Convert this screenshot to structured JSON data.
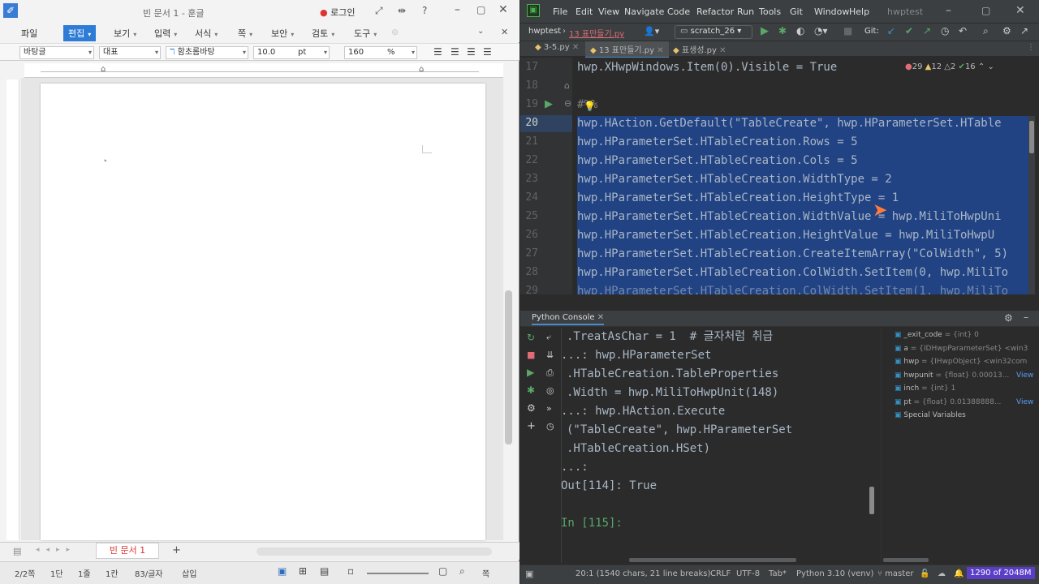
{
  "hwp": {
    "window_title": "빈 문서 1 - 훈글",
    "login_label": "로그인",
    "menu": [
      "파일",
      "편집",
      "보기",
      "입력",
      "서식",
      "쪽",
      "보안",
      "검토",
      "도구"
    ],
    "active_menu": "편집",
    "format": {
      "style": "바탕글",
      "face": "대표",
      "font": "함초롬바탕",
      "size": "10.0",
      "unit": "pt",
      "zoom": "160",
      "zoom_unit": "%"
    },
    "doc_tab": "빈 문서 1",
    "status": {
      "page": "2/2쪽",
      "section": "1단",
      "line": "1줄",
      "col": "1칸",
      "chars": "83/글자",
      "mode": "삽입",
      "extra": "쪽"
    }
  },
  "ide": {
    "menu": [
      "File",
      "Edit",
      "View",
      "Navigate",
      "Code",
      "Refactor",
      "Run",
      "Tools",
      "Git",
      "Window",
      "Help"
    ],
    "project_title": "hwptest",
    "nav": {
      "project": "hwptest",
      "file": "13 표만들기.py",
      "run_config": "scratch_26",
      "git_label": "Git:"
    },
    "file_tabs": [
      "3-5.py",
      "13 표만들기.py",
      "표생성.py"
    ],
    "inspections": {
      "errors": "29",
      "warnings": "12",
      "weak": "2",
      "ok": "16"
    },
    "code": [
      {
        "n": "17",
        "text": "hwp.XHwpWindows.Item(0).Visible = True"
      },
      {
        "n": "18",
        "text": ""
      },
      {
        "n": "19",
        "text": "#%%"
      },
      {
        "n": "20",
        "text": "hwp.HAction.GetDefault(\"TableCreate\", hwp.HParameterSet.HTable"
      },
      {
        "n": "21",
        "text": "hwp.HParameterSet.HTableCreation.Rows = 5"
      },
      {
        "n": "22",
        "text": "hwp.HParameterSet.HTableCreation.Cols = 5"
      },
      {
        "n": "23",
        "text": "hwp.HParameterSet.HTableCreation.WidthType = 2"
      },
      {
        "n": "24",
        "text": "hwp.HParameterSet.HTableCreation.HeightType = 1"
      },
      {
        "n": "25",
        "text": "hwp.HParameterSet.HTableCreation.WidthValue = hwp.MiliToHwpUni"
      },
      {
        "n": "26",
        "text": "hwp.HParameterSet.HTableCreation.HeightValue = hwp.MiliToHwpU"
      },
      {
        "n": "27",
        "text": "hwp.HParameterSet.HTableCreation.CreateItemArray(\"ColWidth\", 5)"
      },
      {
        "n": "28",
        "text": "hwp.HParameterSet.HTableCreation.ColWidth.SetItem(0, hwp.MiliTo"
      },
      {
        "n": "29",
        "text": "hwp.HParameterSet.HTableCreation.ColWidth.SetItem(1, hwp.MiliTo"
      }
    ],
    "console_title": "Python Console",
    "console_lines": [
      ".TreatAsChar = 1  # 글자처럼 취급",
      "...: hwp.HParameterSet",
      ".HTableCreation.TableProperties",
      ".Width = hwp.MiliToHwpUnit(148)",
      "...: hwp.HAction.Execute",
      "(\"TableCreate\", hwp.HParameterSet",
      ".HTableCreation.HSet)",
      "...:",
      "Out[114]: True",
      "",
      "In [115]:"
    ],
    "variables": [
      {
        "name": "_exit_code",
        "type": "= {int} 0",
        "view": ""
      },
      {
        "name": "a",
        "type": "= {IDHwpParameterSet} <win3",
        "view": ""
      },
      {
        "name": "hwp",
        "type": "= {IHwpObject} <win32com",
        "view": ""
      },
      {
        "name": "hwpunit",
        "type": "= {float} 0.00013...",
        "view": "View"
      },
      {
        "name": "inch",
        "type": "= {int} 1",
        "view": ""
      },
      {
        "name": "pt",
        "type": "= {float} 0.01388888...",
        "view": "View"
      },
      {
        "name": "Special Variables",
        "type": "",
        "view": ""
      }
    ],
    "status": {
      "pos": "20:1 (1540 chars, 21 line breaks)",
      "eol": "CRLF",
      "enc": "UTF-8",
      "indent": "Tab*",
      "interp": "Python 3.10 (venv)",
      "branch": "master",
      "mem": "1290 of 2048M"
    }
  }
}
